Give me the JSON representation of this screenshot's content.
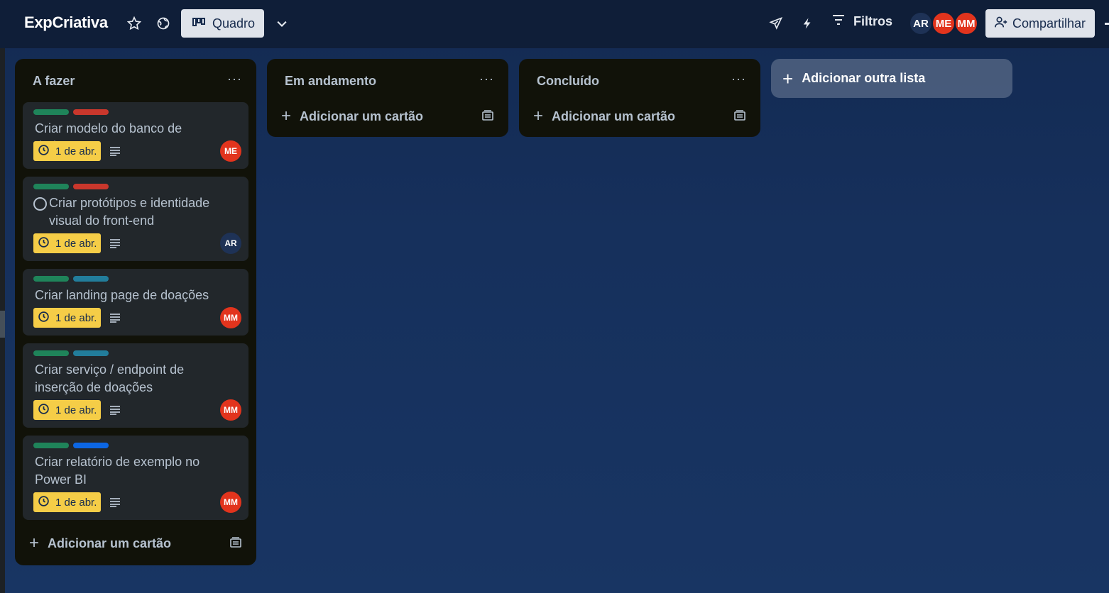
{
  "header": {
    "board_title": "ExpCriativa",
    "view_label": "Quadro",
    "filters_label": "Filtros",
    "share_label": "Compartilhar",
    "members": [
      "AR",
      "ME",
      "MM"
    ]
  },
  "lists": [
    {
      "title": "A fazer",
      "add_card_label": "Adicionar um cartão",
      "cards": [
        {
          "title": "Criar modelo do banco de dados",
          "labels": [
            "#1f845a",
            "#c9372c"
          ],
          "due": "1 de abr.",
          "member": "ME"
        },
        {
          "title": "Criar protótipos e identidade visual do front-end",
          "labels": [
            "#1f845a",
            "#c9372c"
          ],
          "due": "1 de abr.",
          "member": "AR"
        },
        {
          "title": "Criar landing page de doações",
          "labels": [
            "#1f845a",
            "#227d9b"
          ],
          "due": "1 de abr.",
          "member": "MM"
        },
        {
          "title": "Criar serviço / endpoint de inserção de doações",
          "labels": [
            "#1f845a",
            "#227d9b"
          ],
          "due": "1 de abr.",
          "member": "MM"
        },
        {
          "title": "Criar relatório de exemplo no Power BI",
          "labels": [
            "#1f845a",
            "#0c66e4"
          ],
          "due": "1 de abr.",
          "member": "MM"
        }
      ]
    },
    {
      "title": "Em andamento",
      "add_card_label": "Adicionar um cartão",
      "cards": []
    },
    {
      "title": "Concluído",
      "add_card_label": "Adicionar um cartão",
      "cards": []
    }
  ],
  "add_list_label": "Adicionar outra lista",
  "colors": {
    "header_bg": "#0f1e38",
    "board_bg": "#16305c",
    "list_bg": "#111209",
    "card_bg": "#22272b",
    "due_bg": "#f5cd47",
    "member_red": "#e2341d"
  },
  "icons": [
    "star-icon",
    "globe-icon",
    "board-icon",
    "chevron-down-icon",
    "rocket-icon",
    "bolt-icon",
    "filter-icon",
    "add-member-icon",
    "more-icon",
    "plus-icon",
    "template-icon",
    "clock-icon",
    "description-icon",
    "checkbox-circle-icon"
  ]
}
